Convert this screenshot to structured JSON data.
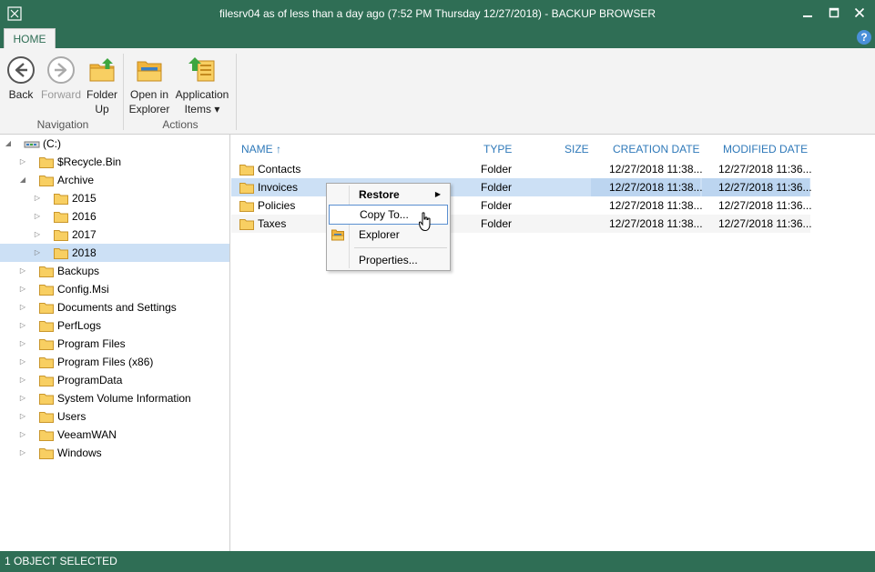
{
  "window": {
    "title": "filesrv04 as of less than a day ago (7:52 PM Thursday 12/27/2018) - BACKUP BROWSER",
    "minimize": "▬",
    "maximize": "☐",
    "close": "✕"
  },
  "tabs": {
    "home": "HOME",
    "help": "?"
  },
  "ribbon": {
    "back": "Back",
    "forward": "Forward",
    "folder_up_1": "Folder",
    "folder_up_2": "Up",
    "open_explorer_1": "Open in",
    "open_explorer_2": "Explorer",
    "app_items_1": "Application",
    "app_items_2": "Items ▾",
    "group_navigation": "Navigation",
    "group_actions": "Actions"
  },
  "tree": {
    "root": "(C:)",
    "items": [
      "$Recycle.Bin",
      "Archive",
      "2015",
      "2016",
      "2017",
      "2018",
      "Backups",
      "Config.Msi",
      "Documents and Settings",
      "PerfLogs",
      "Program Files",
      "Program Files (x86)",
      "ProgramData",
      "System Volume Information",
      "Users",
      "VeeamWAN",
      "Windows"
    ]
  },
  "list": {
    "columns": {
      "name": "NAME",
      "sort_arrow": "↑",
      "type": "TYPE",
      "size": "SIZE",
      "creation": "CREATION DATE",
      "modified": "MODIFIED DATE"
    },
    "rows": [
      {
        "name": "Contacts",
        "type": "Folder",
        "size": "",
        "created": "12/27/2018 11:38...",
        "modified": "12/27/2018 11:36..."
      },
      {
        "name": "Invoices",
        "type": "Folder",
        "size": "",
        "created": "12/27/2018 11:38...",
        "modified": "12/27/2018 11:36..."
      },
      {
        "name": "Policies",
        "type": "Folder",
        "size": "",
        "created": "12/27/2018 11:38...",
        "modified": "12/27/2018 11:36..."
      },
      {
        "name": "Taxes",
        "type": "Folder",
        "size": "",
        "created": "12/27/2018 11:38...",
        "modified": "12/27/2018 11:36..."
      }
    ]
  },
  "context_menu": {
    "restore": "Restore",
    "copy_to": "Copy To...",
    "explorer": "Explorer",
    "properties": "Properties..."
  },
  "status": {
    "text": "1 OBJECT SELECTED"
  },
  "colors": {
    "accent": "#2f6e55",
    "selection": "#cce0f5",
    "header_link": "#2f79b9"
  }
}
